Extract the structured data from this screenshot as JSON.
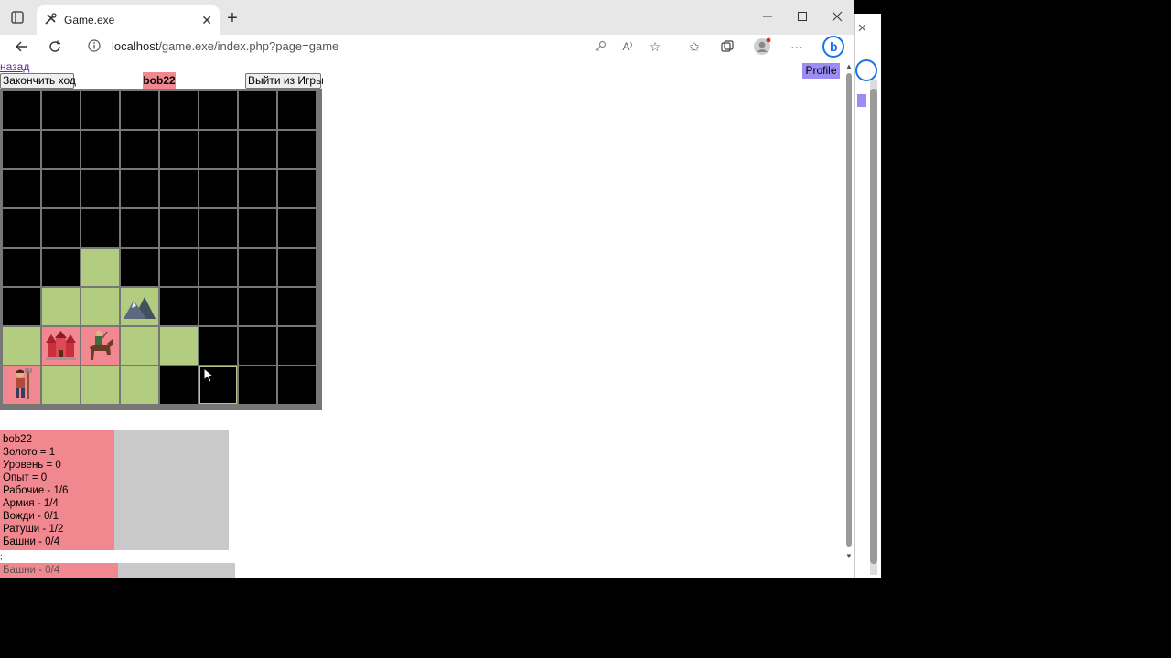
{
  "browser": {
    "tab_title": "Game.exe",
    "url_host": "localhost",
    "url_path": "/game.exe/index.php?page=game"
  },
  "page": {
    "back_link": "назад",
    "end_turn": "Закончить ход",
    "player_name": "bob22",
    "exit_game": "Выйти из Игры",
    "profile": "Profile"
  },
  "board": {
    "cols": 8,
    "rows": 8,
    "cells": [
      "fog",
      "fog",
      "fog",
      "fog",
      "fog",
      "fog",
      "fog",
      "fog",
      "fog",
      "fog",
      "fog",
      "fog",
      "fog",
      "fog",
      "fog",
      "fog",
      "fog",
      "fog",
      "fog",
      "fog",
      "fog",
      "fog",
      "fog",
      "fog",
      "fog",
      "fog",
      "fog",
      "fog",
      "fog",
      "fog",
      "fog",
      "fog",
      "fog",
      "fog",
      "grass",
      "fog",
      "fog",
      "fog",
      "fog",
      "fog",
      "fog",
      "grass",
      "grass",
      "mountain",
      "fog",
      "fog",
      "fog",
      "fog",
      "grass",
      "town-hall",
      "knight",
      "grass",
      "grass",
      "fog",
      "fog",
      "fog",
      "worker",
      "grass",
      "grass",
      "grass",
      "fog",
      "selected",
      "fog",
      "fog"
    ]
  },
  "stats": {
    "lines": [
      "bob22",
      "Золото = 1",
      "Уровень = 0",
      "Опыт = 0",
      "Рабочие - 1/6",
      "Армия - 1/4",
      "Вожди - 0/1",
      "Ратуши - 1/2",
      "Башни - 0/4"
    ],
    "footer_line": "Башни - 0/4"
  },
  "colors": {
    "player": "#f2888f",
    "grass": "#b2cc80",
    "profile": "#9b8cf5",
    "fog": "#000000"
  }
}
